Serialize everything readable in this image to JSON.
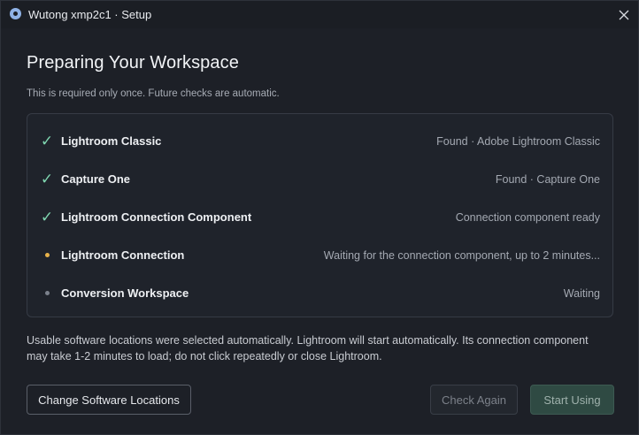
{
  "window": {
    "title": "Wutong xmp2c1 · Setup"
  },
  "header": {
    "title": "Preparing Your Workspace",
    "subtitle": "This is required only once. Future checks are automatic."
  },
  "checks": [
    {
      "name": "Lightroom Classic",
      "status": "Found · Adobe Lightroom Classic",
      "state": "done"
    },
    {
      "name": "Capture One",
      "status": "Found · Capture One",
      "state": "done"
    },
    {
      "name": "Lightroom Connection Component",
      "status": "Connection component ready",
      "state": "done"
    },
    {
      "name": "Lightroom Connection",
      "status": "Waiting for the connection component, up to 2 minutes...",
      "state": "active"
    },
    {
      "name": "Conversion Workspace",
      "status": "Waiting",
      "state": "pending"
    }
  ],
  "note": "Usable software locations were selected automatically. Lightroom will start automatically. Its connection component may take 1-2 minutes to load; do not click repeatedly or close Lightroom.",
  "buttons": {
    "change_locations": "Change Software Locations",
    "check_again": "Check Again",
    "start_using": "Start Using"
  },
  "icons": {
    "app": "app-logo-icon",
    "close": "close-icon",
    "done": "checkmark-icon",
    "active": "amber-dot-icon",
    "pending": "gray-dot-icon"
  },
  "colors": {
    "check": "#7fd6b0",
    "active_dot": "#e7b24a",
    "pending_dot": "#7b818c",
    "primary_button": "#2f4a43"
  }
}
